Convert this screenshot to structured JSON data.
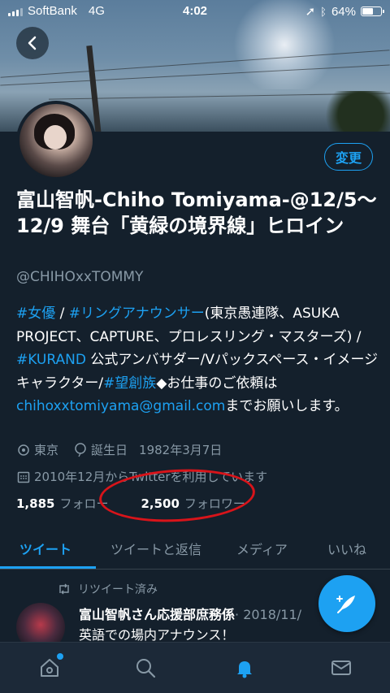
{
  "status_bar": {
    "carrier": "SoftBank",
    "network": "4G",
    "time": "4:02",
    "battery": "64%",
    "battery_level": 0.64
  },
  "profile": {
    "name": "富山智帆-Chiho Tomiyama-@12/5〜12/9 舞台「黄緑の境界線」ヒロイン",
    "handle": "@CHIHOxxTOMMY",
    "edit_label": "変更",
    "bio": [
      {
        "text": "#女優",
        "link": true
      },
      {
        "text": " / ",
        "link": false
      },
      {
        "text": "#リングアナウンサー",
        "link": true
      },
      {
        "text": "(東京愚連隊、ASUKA PROJECT、CAPTURE、プロレスリング・マスターズ) / ",
        "link": false
      },
      {
        "text": "#KURAND",
        "link": true
      },
      {
        "text": " 公式アンバサダー/Vパックスペース・イメージキャラクター/",
        "link": false
      },
      {
        "text": "#望創族",
        "link": true
      },
      {
        "text": "◆お仕事のご依頼は",
        "link": false
      },
      {
        "text": "chihoxxtomiyama@gmail.com",
        "link": true
      },
      {
        "text": "までお願いします。",
        "link": false
      }
    ],
    "location": "東京",
    "birthday_label": "誕生日",
    "birthday": "1982年3月7日",
    "joined": "2010年12月からTwitterを利用しています",
    "following_count": "1,885",
    "following_label": "フォロー",
    "followers_count": "2,500",
    "followers_label": "フォロワー"
  },
  "tabs": [
    {
      "label": "ツイート",
      "active": true
    },
    {
      "label": "ツイートと返信",
      "active": false
    },
    {
      "label": "メディア",
      "active": false
    },
    {
      "label": "いいね",
      "active": false
    }
  ],
  "tweet": {
    "retweet_label": "リツイート済み",
    "author": "富山智帆さん応援部庶務係",
    "date_snippet": "· 2018/11/",
    "text": "英語での場内アナウンス！"
  },
  "icons": {
    "back": "chevron-left-icon",
    "location": "location-pin-icon",
    "birthday": "balloon-icon",
    "joined": "calendar-icon",
    "retweet": "retweet-icon",
    "compose": "compose-feather-icon",
    "home": "home-icon",
    "search": "search-icon",
    "notifications": "bell-icon",
    "messages": "mail-icon"
  },
  "colors": {
    "accent": "#1da1f2",
    "background": "#14202c",
    "annotation_circle": "#d8141a"
  }
}
